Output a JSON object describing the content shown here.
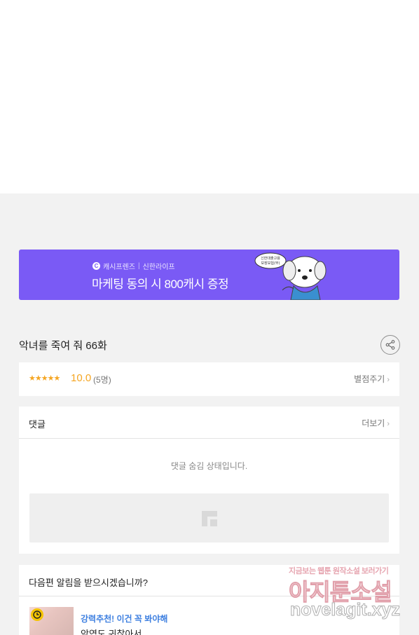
{
  "banner": {
    "brand": "캐시프렌즈",
    "partner": "신한라이프",
    "headline": "마케팅 동의 시 800캐시 증정",
    "bubble_text_1": "신한대출고용",
    "bubble_text_2": "보장보험(무)"
  },
  "episode": {
    "title": "악녀를 죽여 줘 66화"
  },
  "rating": {
    "stars": "★★★★★",
    "score": "10.0",
    "count": "(5명)",
    "rate_link": "별점주기"
  },
  "comments": {
    "title": "댓글",
    "more": "더보기",
    "hidden_message": "댓글 숨김 상태입니다."
  },
  "notify": {
    "title": "다음편 알림을 받으시겠습니까?",
    "recommend_label": "강력추천! 이건 꼭 봐야해",
    "recommend_work": "악역도 귀찮아서"
  },
  "watermark": {
    "tagline": "지금보는 웹툰 원작소설 보러가기",
    "name": "아지툰소설",
    "url": "novelagit.xyz"
  },
  "colors": {
    "banner_bg": "#7a5af5",
    "star": "#f5a623",
    "link_blue": "#3d7fe0",
    "page_bg": "#f2f2f2"
  }
}
